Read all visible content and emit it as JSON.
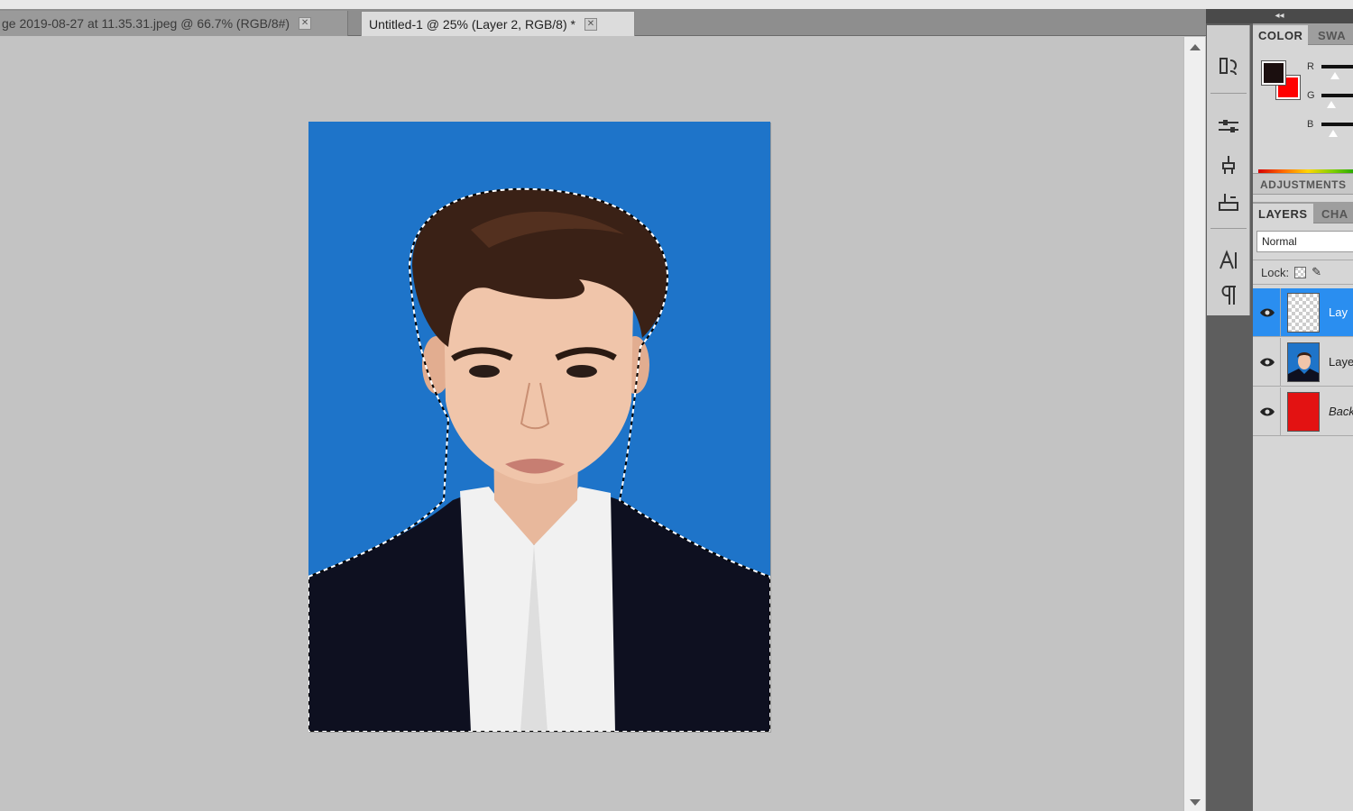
{
  "tabs": [
    {
      "label": "ge 2019-08-27 at 11.35.31.jpeg @ 66.7% (RGB/8#)",
      "close": "✕",
      "active": false
    },
    {
      "label": "Untitled-1 @ 25% (Layer 2, RGB/8) *",
      "close": "✕",
      "active": true
    }
  ],
  "dock": {
    "collapse_glyph": "◂◂",
    "tools": [
      "history-icon",
      "adjust-sliders-icon",
      "clone-source-icon",
      "brush-presets-icon",
      "character-icon",
      "paragraph-icon"
    ]
  },
  "color_panel": {
    "tabs": [
      "COLOR",
      "SWA"
    ],
    "foreground_color": "#1b0f0f",
    "background_color": "#ff0000",
    "channels": [
      "R",
      "G",
      "B"
    ]
  },
  "adjustments_label": "ADJUSTMENTS",
  "layers_panel": {
    "tabs": [
      "LAYERS",
      "CHA"
    ],
    "blend_mode": "Normal",
    "lock_label": "Lock:",
    "layers": [
      {
        "name": "Lay",
        "thumb": "transparent",
        "selected": true
      },
      {
        "name": "Laye",
        "thumb": "photo",
        "selected": false
      },
      {
        "name": "Back",
        "thumb": "red",
        "selected": false
      }
    ]
  },
  "colors": {
    "canvas_background": "#1e74c9",
    "selection_highlight": "#2a8ef0",
    "workspace": "#c3c3c3"
  }
}
